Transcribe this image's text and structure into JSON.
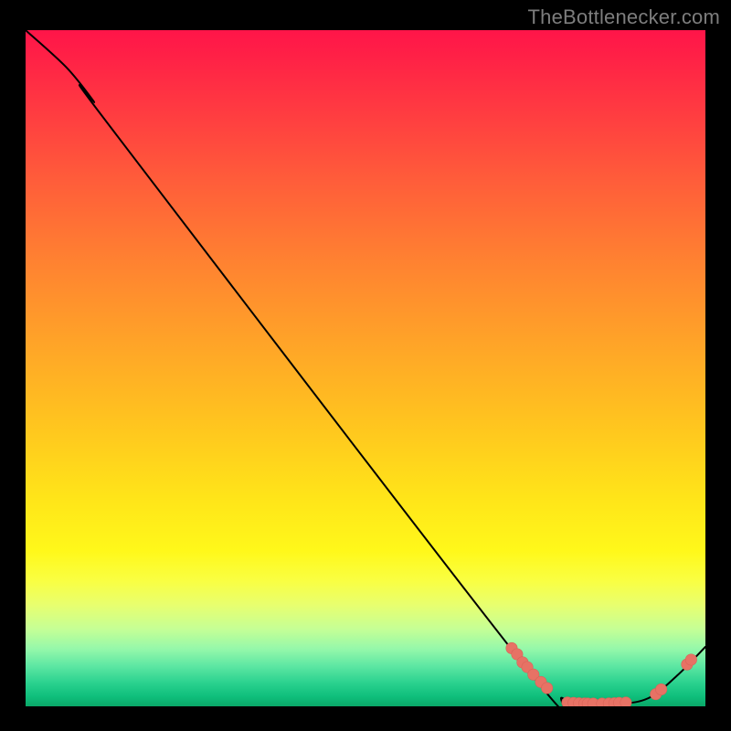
{
  "attribution": "TheBottlenecker.com",
  "colors": {
    "page_bg": "#000000",
    "attribution_text": "#7d7d7d",
    "curve_stroke": "#000000",
    "marker_fill": "#e77265",
    "marker_stroke": "#d86358"
  },
  "chart_data": {
    "type": "line",
    "title": "",
    "xlabel": "",
    "ylabel": "",
    "xlim": [
      0,
      100
    ],
    "ylim": [
      0,
      100
    ],
    "curve": [
      {
        "x": 0,
        "y": 100
      },
      {
        "x": 6,
        "y": 94.5
      },
      {
        "x": 10,
        "y": 89.5
      },
      {
        "x": 13,
        "y": 85
      },
      {
        "x": 73,
        "y": 6.5
      },
      {
        "x": 79,
        "y": 1.2
      },
      {
        "x": 82,
        "y": 0.4
      },
      {
        "x": 88,
        "y": 0.4
      },
      {
        "x": 92,
        "y": 1.4
      },
      {
        "x": 96,
        "y": 4.7
      },
      {
        "x": 100,
        "y": 8.8
      }
    ],
    "markers": [
      {
        "x": 71.5,
        "y": 8.6
      },
      {
        "x": 72.3,
        "y": 7.7
      },
      {
        "x": 73.1,
        "y": 6.5
      },
      {
        "x": 73.8,
        "y": 5.8
      },
      {
        "x": 74.7,
        "y": 4.7
      },
      {
        "x": 75.8,
        "y": 3.6
      },
      {
        "x": 76.7,
        "y": 2.7
      },
      {
        "x": 79.7,
        "y": 0.55
      },
      {
        "x": 80.6,
        "y": 0.5
      },
      {
        "x": 81.4,
        "y": 0.45
      },
      {
        "x": 82.2,
        "y": 0.42
      },
      {
        "x": 82.7,
        "y": 0.4
      },
      {
        "x": 83.5,
        "y": 0.4
      },
      {
        "x": 84.8,
        "y": 0.4
      },
      {
        "x": 85.8,
        "y": 0.42
      },
      {
        "x": 86.6,
        "y": 0.45
      },
      {
        "x": 87.3,
        "y": 0.5
      },
      {
        "x": 88.3,
        "y": 0.55
      },
      {
        "x": 92.7,
        "y": 1.8
      },
      {
        "x": 93.5,
        "y": 2.5
      },
      {
        "x": 97.3,
        "y": 6.2
      },
      {
        "x": 97.9,
        "y": 6.9
      }
    ]
  }
}
